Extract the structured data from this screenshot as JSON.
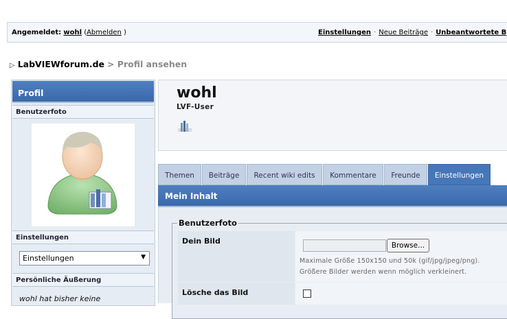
{
  "topbar": {
    "logged_in_label": "Angemeldet:",
    "username": "wohl",
    "logout_open": "(",
    "logout_link": "Abmelden",
    "logout_close": ")",
    "links": [
      "Einstellungen",
      "Neue Beiträge",
      "Unbeantwortete B"
    ],
    "separator": "·"
  },
  "breadcrumb": {
    "arrow": "▷",
    "home": "LabVIEWforum.de",
    "current": "> Profil ansehen"
  },
  "sidebar": {
    "title": "Profil",
    "photo_heading": "Benutzerfoto",
    "settings_heading": "Einstellungen",
    "settings_select_value": "Einstellungen",
    "statement_heading": "Persönliche Äußerung",
    "statement_text": "wohl hat bisher keine"
  },
  "profile": {
    "name": "wohl",
    "rank": "LVF-User"
  },
  "tabs": [
    {
      "label": "Themen",
      "active": false
    },
    {
      "label": "Beiträge",
      "active": false
    },
    {
      "label": "Recent wiki edits",
      "active": false
    },
    {
      "label": "Kommentare",
      "active": false
    },
    {
      "label": "Freunde",
      "active": false
    },
    {
      "label": "Einstellungen",
      "active": true
    }
  ],
  "content": {
    "heading": "Mein Inhalt",
    "fieldset_legend": "Benutzerfoto",
    "your_picture_label": "Dein Bild",
    "browse_button": "Browse...",
    "hint_line1": "Maximale Größe 150x150 und 50k (gif/jpg/jpeg/png).",
    "hint_line2": "Größere Bilder werden wenn möglich verkleinert.",
    "delete_picture_label": "Lösche das Bild",
    "delete_checked": false
  },
  "colors": {
    "header_blue": "#3a69ab",
    "tab_inactive": "#c2d1e4",
    "tab_active": "#4677b8"
  }
}
